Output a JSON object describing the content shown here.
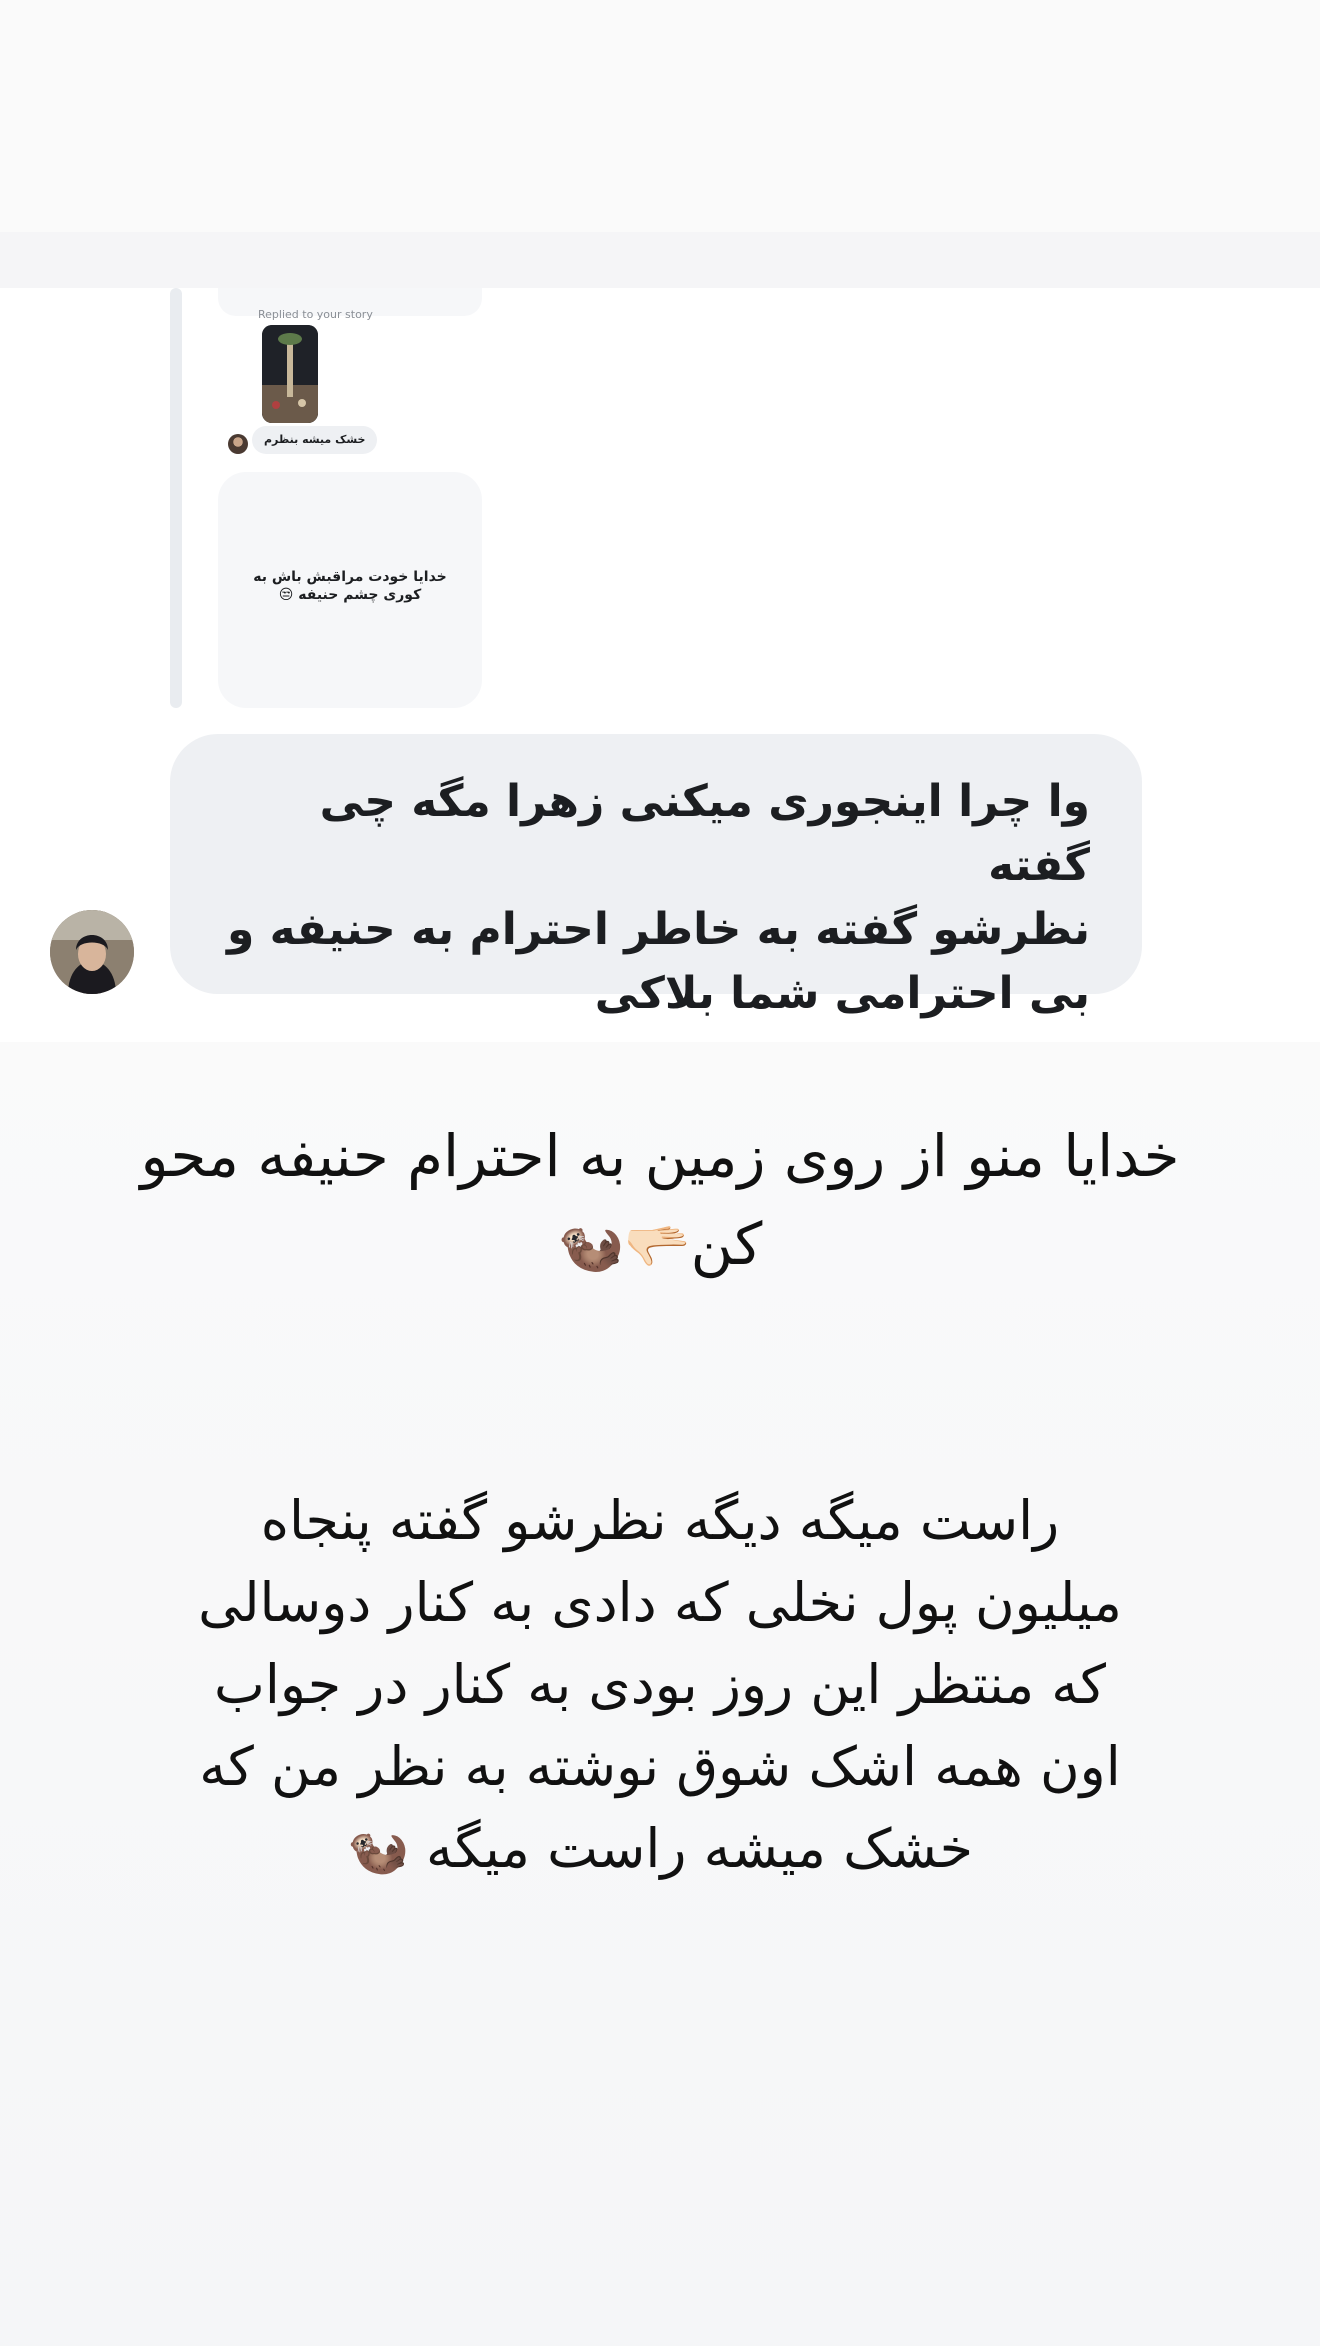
{
  "story": {
    "embedded_screenshot": {
      "reply_label": "Replied to your story",
      "reply_bubble_text": "خشک میشه بنظرم",
      "card_text": "خدایا خودت مراقبش باش به\nکوری چشم حنیفه 😒",
      "message_text": "وا چرا اینجوری میکنی  زهرا مگه چی گفته\nنظرشو گفته به خاطر احترام به حنیفه و\nبی احترامی شما بلاکی"
    },
    "caption_1": {
      "text": "خدایا منو از روی زمین به احترام حنیفه محو کن",
      "emoji": "🫳🏻🦦"
    },
    "caption_2": {
      "text": "راست میگه دیگه نظرشو گفته پنجاه میلیون پول نخلی که دادی به کنار دوسالی که منتظر این روز بودی به کنار در جواب اون همه اشک شوق نوشته به نظر من که خشک میشه راست میگه",
      "emoji": "🦦"
    }
  },
  "colors": {
    "bubble_bg": "#eef0f3",
    "text": "#1c1e21",
    "page_bg": "#f7f7f9"
  }
}
